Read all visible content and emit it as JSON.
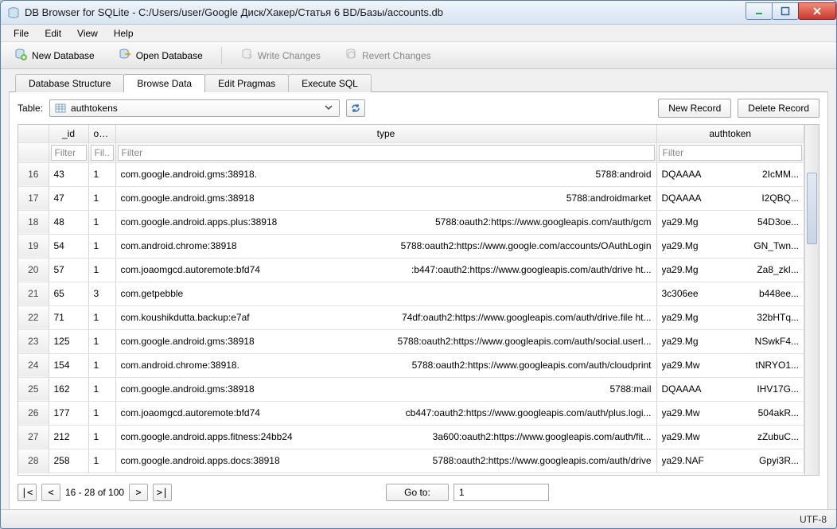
{
  "window": {
    "title": "DB Browser for SQLite - C:/Users/user/Google Диск/Хакер/Статья 6 BD/Базы/accounts.db"
  },
  "menu": {
    "items": [
      "File",
      "Edit",
      "View",
      "Help"
    ]
  },
  "toolbar": {
    "new_db": "New Database",
    "open_db": "Open Database",
    "write_changes": "Write Changes",
    "revert_changes": "Revert Changes"
  },
  "tabs": {
    "items": [
      "Database Structure",
      "Browse Data",
      "Edit Pragmas",
      "Execute SQL"
    ],
    "active_index": 1
  },
  "browse": {
    "table_label": "Table:",
    "selected_table": "authtokens",
    "new_record": "New Record",
    "delete_record": "Delete Record",
    "columns": {
      "row": "",
      "id": "_id",
      "ount": "ount",
      "type": "type",
      "authtoken": "authtoken"
    },
    "filter_placeholder": {
      "id": "Filter",
      "ount": "Fil...",
      "type": "Filter",
      "authtoken": "Filter"
    },
    "rows": [
      {
        "n": "16",
        "id": "43",
        "ount": "1",
        "type_l": "com.google.android.gms:38918.",
        "type_r": "5788:android",
        "tok_l": "DQAAAA",
        "tok_r": "2IcMM..."
      },
      {
        "n": "17",
        "id": "47",
        "ount": "1",
        "type_l": "com.google.android.gms:38918",
        "type_r": "5788:androidmarket",
        "tok_l": "DQAAAA",
        "tok_r": "I2QBQ..."
      },
      {
        "n": "18",
        "id": "48",
        "ount": "1",
        "type_l": "com.google.android.apps.plus:38918",
        "type_r": "5788:oauth2:https://www.googleapis.com/auth/gcm",
        "tok_l": "ya29.Mg",
        "tok_r": "54D3oe..."
      },
      {
        "n": "19",
        "id": "54",
        "ount": "1",
        "type_l": "com.android.chrome:38918",
        "type_r": "5788:oauth2:https://www.google.com/accounts/OAuthLogin",
        "tok_l": "ya29.Mg",
        "tok_r": "GN_Twn..."
      },
      {
        "n": "20",
        "id": "57",
        "ount": "1",
        "type_l": "com.joaomgcd.autoremote:bfd74",
        "type_r": ":b447:oauth2:https://www.googleapis.com/auth/drive ht...",
        "tok_l": "ya29.Mg",
        "tok_r": "Za8_zkI..."
      },
      {
        "n": "21",
        "id": "65",
        "ount": "3",
        "type_l": "com.getpebble",
        "type_r": "",
        "tok_l": "3c306ee",
        "tok_r": "b448ee..."
      },
      {
        "n": "22",
        "id": "71",
        "ount": "1",
        "type_l": "com.koushikdutta.backup:e7af",
        "type_r": "74df:oauth2:https://www.googleapis.com/auth/drive.file ht...",
        "tok_l": "ya29.Mg",
        "tok_r": "32bHTq..."
      },
      {
        "n": "23",
        "id": "125",
        "ount": "1",
        "type_l": "com.google.android.gms:38918",
        "type_r": "5788:oauth2:https://www.googleapis.com/auth/social.userl...",
        "tok_l": "ya29.Mg",
        "tok_r": "NSwkF4..."
      },
      {
        "n": "24",
        "id": "154",
        "ount": "1",
        "type_l": "com.android.chrome:38918.",
        "type_r": "5788:oauth2:https://www.googleapis.com/auth/cloudprint",
        "tok_l": "ya29.Mw",
        "tok_r": "tNRYO1..."
      },
      {
        "n": "25",
        "id": "162",
        "ount": "1",
        "type_l": "com.google.android.gms:38918",
        "type_r": "5788:mail",
        "tok_l": "DQAAAA",
        "tok_r": "IHV17G..."
      },
      {
        "n": "26",
        "id": "177",
        "ount": "1",
        "type_l": "com.joaomgcd.autoremote:bfd74",
        "type_r": "cb447:oauth2:https://www.googleapis.com/auth/plus.logi...",
        "tok_l": "ya29.Mw",
        "tok_r": "504akR..."
      },
      {
        "n": "27",
        "id": "212",
        "ount": "1",
        "type_l": "com.google.android.apps.fitness:24bb24",
        "type_r": "3a600:oauth2:https://www.googleapis.com/auth/fit...",
        "tok_l": "ya29.Mw",
        "tok_r": "zZubuC..."
      },
      {
        "n": "28",
        "id": "258",
        "ount": "1",
        "type_l": "com.google.android.apps.docs:38918",
        "type_r": "5788:oauth2:https://www.googleapis.com/auth/drive",
        "tok_l": "ya29.NAF",
        "tok_r": "Gpyi3R..."
      }
    ],
    "pager": {
      "range": "16 - 28 of 100",
      "goto_label": "Go to:",
      "goto_value": "1"
    }
  },
  "statusbar": {
    "encoding": "UTF-8"
  }
}
